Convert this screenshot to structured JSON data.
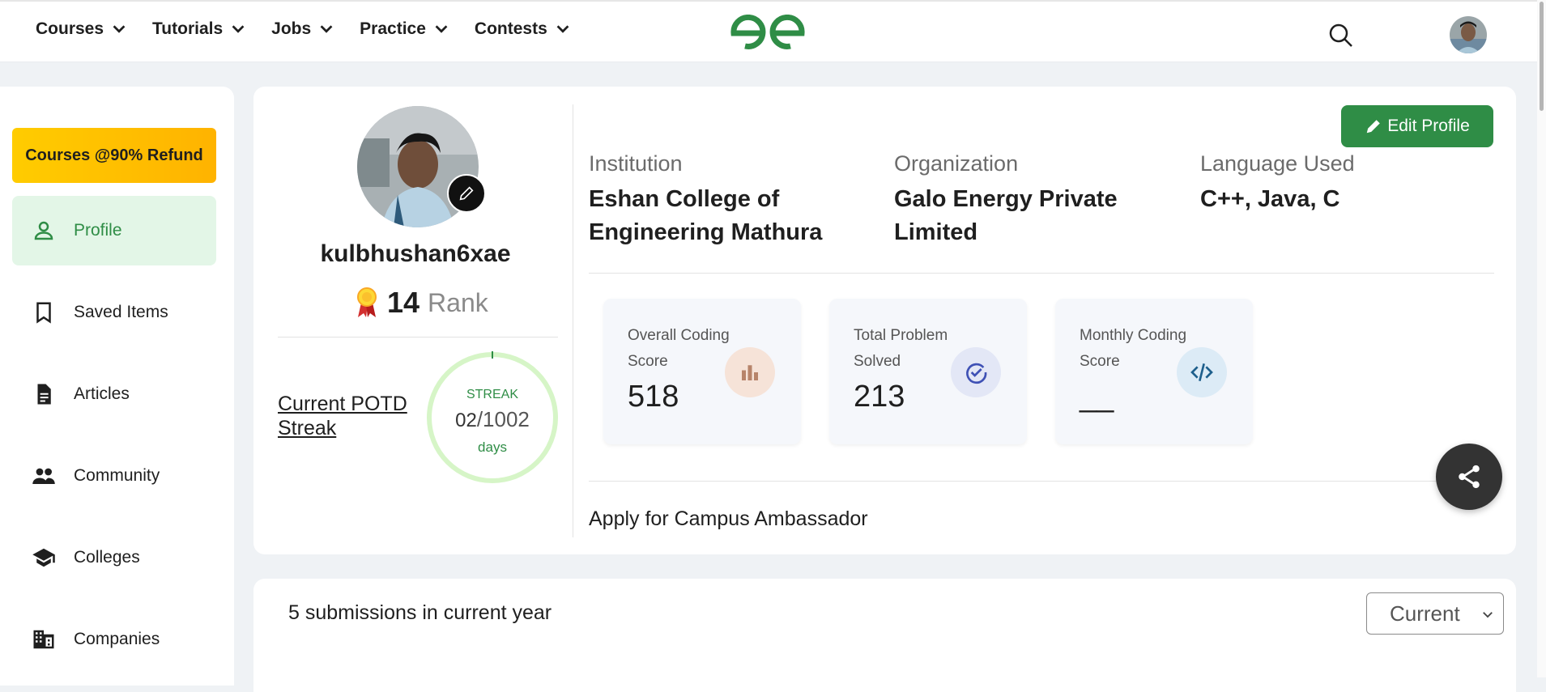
{
  "nav": {
    "items": [
      {
        "label": "Courses"
      },
      {
        "label": "Tutorials"
      },
      {
        "label": "Jobs"
      },
      {
        "label": "Practice"
      },
      {
        "label": "Contests"
      }
    ]
  },
  "sidebar": {
    "promo_label": "Courses @90% Refund",
    "items": [
      {
        "label": "Profile",
        "icon": "person-icon"
      },
      {
        "label": "Saved Items",
        "icon": "bookmark-icon"
      },
      {
        "label": "Articles",
        "icon": "article-icon"
      },
      {
        "label": "Community",
        "icon": "people-icon"
      },
      {
        "label": "Colleges",
        "icon": "graduation-cap-icon"
      },
      {
        "label": "Companies",
        "icon": "building-icon"
      }
    ]
  },
  "profile": {
    "username": "kulbhushan6xae",
    "rank_value": "14",
    "rank_label": "Rank",
    "potd_link": "Current POTD Streak",
    "streak": {
      "label": "STREAK",
      "current": "02",
      "separator": "/",
      "total": "1002",
      "unit": "days"
    },
    "edit_profile_label": "Edit Profile",
    "institution_label": "Institution",
    "institution_value": "Eshan College of Engineering Mathura",
    "organization_label": "Organization",
    "organization_value": "Galo Energy Private Limited",
    "language_label": "Language Used",
    "language_value": "C++, Java, C",
    "scores": [
      {
        "title": "Overall Coding Score",
        "value": "518",
        "icon": "bar-chart-icon"
      },
      {
        "title": "Total Problem Solved",
        "value": "213",
        "icon": "check-circle-icon"
      },
      {
        "title": "Monthly Coding Score",
        "value": "__",
        "icon": "code-icon"
      }
    ],
    "campus_link": "Apply for Campus Ambassador"
  },
  "submissions": {
    "summary": "5 submissions in current year",
    "year_selected": "Current"
  },
  "colors": {
    "brand_green": "#2f8d46",
    "promo_yellow": "#ffc107",
    "active_bg": "#e3f6e7"
  }
}
